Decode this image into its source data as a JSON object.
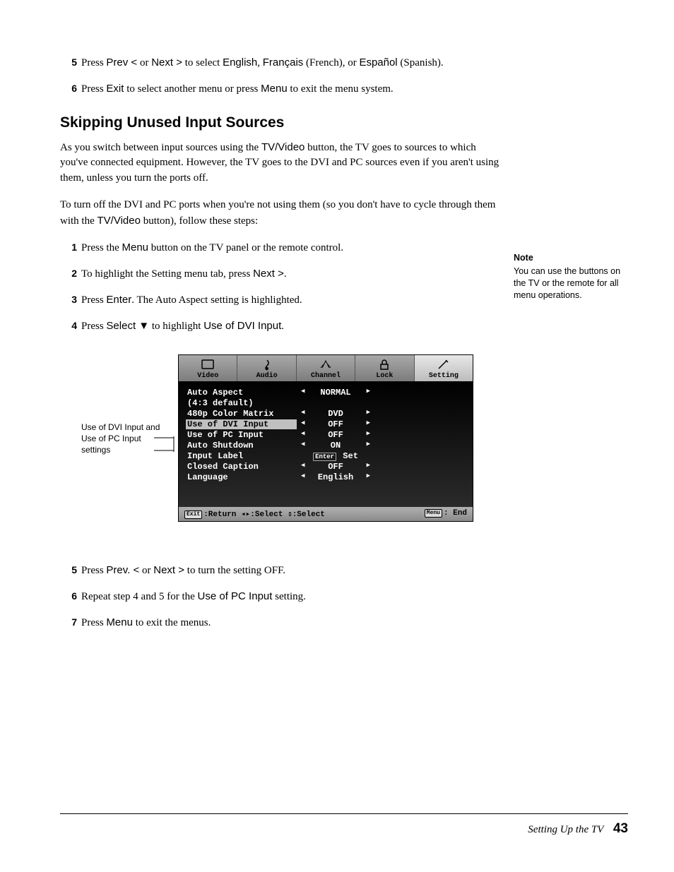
{
  "topSteps": [
    {
      "n": "5",
      "html": "Press <span class=\"sans\">Prev &lt;</span> or <span class=\"sans\">Next &gt;</span> to select <span class=\"sans\">English</span>, <span class=\"sans\">Français</span> (French), or <span class=\"sans\">Español</span> (Spanish)."
    },
    {
      "n": "6",
      "html": "Press <span class=\"sans\">Exit</span> to select another menu or press <span class=\"sans\">Menu</span> to exit the menu system."
    }
  ],
  "sectionTitle": "Skipping Unused Input Sources",
  "para1": "As you switch between input sources using the <span class=\"sans\">TV/Video</span> button, the TV goes to sources to which you've connected equipment. However, the TV goes to the DVI and PC sources even if you aren't using them, unless you turn the ports off.",
  "para2": "To turn off the DVI and PC ports when you're not using them (so you don't have to cycle through them with the <span class=\"sans\">TV/Video</span> button), follow these steps:",
  "midSteps": [
    {
      "n": "1",
      "html": "Press the <span class=\"sans\">Menu</span> button on the TV panel or the remote control."
    },
    {
      "n": "2",
      "html": "To highlight the Setting menu tab, press <span class=\"sans\">Next &gt;</span>."
    },
    {
      "n": "3",
      "html": "Press <span class=\"sans\">Enter</span>. The Auto Aspect setting is highlighted."
    },
    {
      "n": "4",
      "html": "Press <span class=\"sans\">Select ▼</span> to highlight <span class=\"sans\">Use of DVI Input</span>."
    }
  ],
  "bottomSteps": [
    {
      "n": "5",
      "html": "Press <span class=\"sans\">Prev. &lt;</span> or <span class=\"sans\">Next &gt;</span> to turn the setting OFF."
    },
    {
      "n": "6",
      "html": "Repeat step 4 and 5 for the <span class=\"sans\">Use of PC Input</span> setting."
    },
    {
      "n": "7",
      "html": "Press <span class=\"sans\">Menu</span> to exit the menus."
    }
  ],
  "sidebar": {
    "head": "Note",
    "body": "You can use the buttons on the TV or the remote for all menu operations."
  },
  "callout": "Use of DVI Input and<br>Use of PC Input settings",
  "osd": {
    "tabs": [
      {
        "label": "Video",
        "icon": "video"
      },
      {
        "label": "Audio",
        "icon": "audio"
      },
      {
        "label": "Channel",
        "icon": "channel"
      },
      {
        "label": "Lock",
        "icon": "lock"
      },
      {
        "label": "Setting",
        "icon": "setting",
        "active": true
      }
    ],
    "rows": [
      {
        "label": "Auto Aspect",
        "value": "NORMAL",
        "arrows": true
      },
      {
        "label": "(4:3 default)",
        "value": "",
        "arrows": false
      },
      {
        "label": "480p Color Matrix",
        "value": "DVD",
        "arrows": true
      },
      {
        "label": "Use of DVI Input",
        "value": "OFF",
        "arrows": true,
        "highlight": true
      },
      {
        "label": "Use of PC Input",
        "value": "OFF",
        "arrows": true
      },
      {
        "label": "Auto Shutdown",
        "value": "ON",
        "arrows": true
      },
      {
        "label": "Input Label",
        "value": "Set",
        "enter": true
      },
      {
        "label": "Closed Caption",
        "value": "OFF",
        "arrows": true
      },
      {
        "label": "Language",
        "value": "English",
        "arrows": true
      }
    ],
    "footerLeft": "Exit :Return  ◂▸:Select  ⇕:Select",
    "footerRightKey": "Menu",
    "footerRightText": ": End"
  },
  "footer": {
    "chapter": "Setting Up the TV",
    "page": "43"
  }
}
